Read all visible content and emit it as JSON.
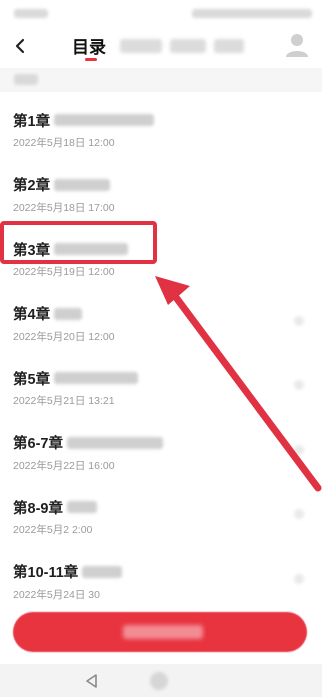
{
  "header": {
    "back_icon": "chevron-left-icon",
    "active_tab": "目录",
    "accent_color": "#e8343f"
  },
  "chapters": [
    {
      "title": "第1章",
      "date": "2022年5月18日 12:00"
    },
    {
      "title": "第2章",
      "date": "2022年5月18日 17:00"
    },
    {
      "title": "第3章",
      "date": "2022年5月19日 12:00"
    },
    {
      "title": "第4章",
      "date": "2022年5月20日 12:00"
    },
    {
      "title": "第5章",
      "date": "2022年5月21日 13:21"
    },
    {
      "title": "第6-7章",
      "date": "2022年5月22日 16:00"
    },
    {
      "title": "第8-9章",
      "date": "2022年5月2   2:00"
    },
    {
      "title": "第10-11章",
      "date": "2022年5月24日   30"
    }
  ],
  "annotation": {
    "highlight_color": "#e03243",
    "highlighted_chapter": "第3章"
  },
  "navbar": {
    "back_icon": "triangle-back-icon",
    "home_icon": "circle-home-icon"
  }
}
